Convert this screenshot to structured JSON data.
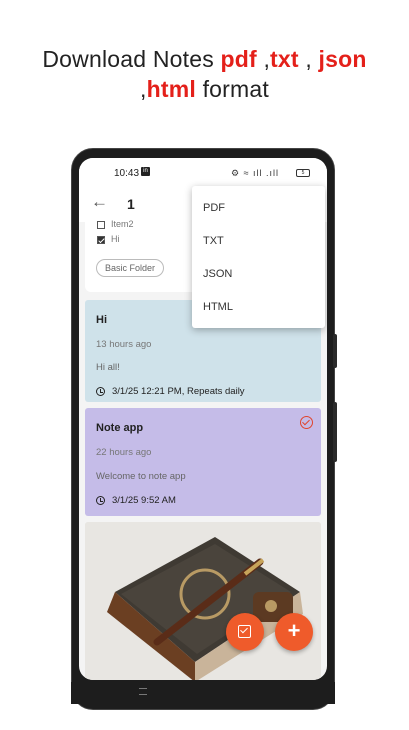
{
  "headline": {
    "line1_prefix": "Download Notes ",
    "pdf": "pdf",
    "sep1": " ,",
    "txt": "txt",
    "sep2": " , ",
    "json": "json",
    "line2_prefix": ",",
    "html": "html",
    "line2_suffix": " format"
  },
  "status_bar": {
    "time": "10:43",
    "app_badge": "in",
    "icons": "⚙ ≈ ıll .ıll",
    "battery": "5"
  },
  "app_bar": {
    "back_icon": "arrow-left-icon",
    "count": "1"
  },
  "folder_card": {
    "items": [
      {
        "label": "Item2",
        "checked": false
      },
      {
        "label": "Hi",
        "checked": true
      }
    ],
    "folder_chip": "Basic Folder"
  },
  "notes": [
    {
      "title": "Hi",
      "time": "13 hours ago",
      "body": "Hi all!",
      "reminder": "3/1/25 12:21 PM, Repeats daily",
      "color": "#cfe2ea"
    },
    {
      "title": "Note app",
      "time": "22 hours ago",
      "body": "Welcome to note app",
      "reminder": "3/1/25 9:52 AM",
      "color": "#c5bce8",
      "done": true
    }
  ],
  "menu": {
    "items": [
      "PDF",
      "TXT",
      "JSON",
      "HTML"
    ]
  },
  "fabs": {
    "checklist_icon": "checklist-icon",
    "add_label": "+"
  },
  "colors": {
    "accent": "#ef5b2b",
    "headline_highlight": "#e4201a"
  }
}
